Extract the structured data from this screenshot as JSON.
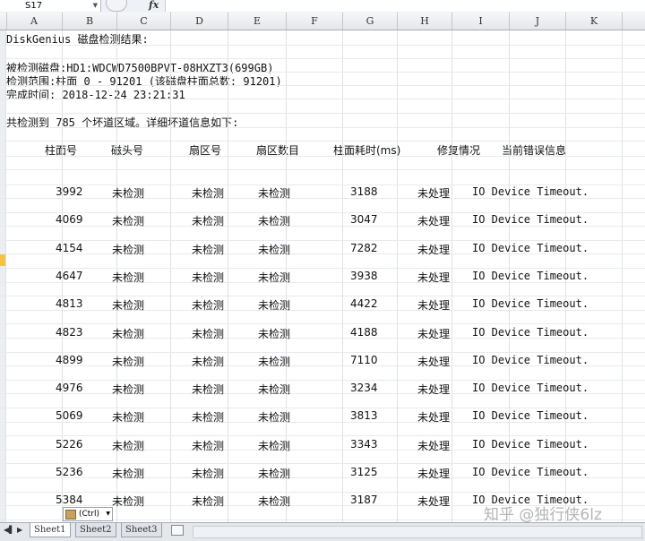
{
  "formula_bar": {
    "cell_ref": "S17",
    "fx": "fx",
    "formula": ""
  },
  "columns": [
    "A",
    "B",
    "C",
    "D",
    "E",
    "F",
    "G",
    "H",
    "I",
    "J",
    "K"
  ],
  "report": {
    "title": "DiskGenius 磁盘检测结果:",
    "disk_line": "被检测磁盘:HD1:WDCWD7500BPVT-08HXZT3(699GB)",
    "range_line": "检测范围:柱面 0 - 91201 (该磁盘柱面总数: 91201)",
    "time_line": "完成时间: 2018-12-24 23:21:31",
    "summary_line": "共检测到 785 个坏道区域。详细坏道信息如下:"
  },
  "table": {
    "headers": {
      "cylinder": "柱面号",
      "head": "磁头号",
      "sector": "扇区号",
      "sector_count": "扇区数目",
      "time": "柱面耗时(ms)",
      "repair": "修复情况",
      "error": "当前错误信息"
    },
    "rows": [
      {
        "cylinder": "3992",
        "head": "未检测",
        "sector": "未检测",
        "sector_count": "未检测",
        "time": "3188",
        "repair": "未处理",
        "error": "IO Device Timeout."
      },
      {
        "cylinder": "4069",
        "head": "未检测",
        "sector": "未检测",
        "sector_count": "未检测",
        "time": "3047",
        "repair": "未处理",
        "error": "IO Device Timeout."
      },
      {
        "cylinder": "4154",
        "head": "未检测",
        "sector": "未检测",
        "sector_count": "未检测",
        "time": "7282",
        "repair": "未处理",
        "error": "IO Device Timeout."
      },
      {
        "cylinder": "4647",
        "head": "未检测",
        "sector": "未检测",
        "sector_count": "未检测",
        "time": "3938",
        "repair": "未处理",
        "error": "IO Device Timeout."
      },
      {
        "cylinder": "4813",
        "head": "未检测",
        "sector": "未检测",
        "sector_count": "未检测",
        "time": "4422",
        "repair": "未处理",
        "error": "IO Device Timeout."
      },
      {
        "cylinder": "4823",
        "head": "未检测",
        "sector": "未检测",
        "sector_count": "未检测",
        "time": "4188",
        "repair": "未处理",
        "error": "IO Device Timeout."
      },
      {
        "cylinder": "4899",
        "head": "未检测",
        "sector": "未检测",
        "sector_count": "未检测",
        "time": "7110",
        "repair": "未处理",
        "error": "IO Device Timeout."
      },
      {
        "cylinder": "4976",
        "head": "未检测",
        "sector": "未检测",
        "sector_count": "未检测",
        "time": "3234",
        "repair": "未处理",
        "error": "IO Device Timeout."
      },
      {
        "cylinder": "5069",
        "head": "未检测",
        "sector": "未检测",
        "sector_count": "未检测",
        "time": "3813",
        "repair": "未处理",
        "error": "IO Device Timeout."
      },
      {
        "cylinder": "5226",
        "head": "未检测",
        "sector": "未检测",
        "sector_count": "未检测",
        "time": "3343",
        "repair": "未处理",
        "error": "IO Device Timeout."
      },
      {
        "cylinder": "5236",
        "head": "未检测",
        "sector": "未检测",
        "sector_count": "未检测",
        "time": "3125",
        "repair": "未处理",
        "error": "IO Device Timeout."
      },
      {
        "cylinder": "5384",
        "head": "未检测",
        "sector": "未检测",
        "sector_count": "未检测",
        "time": "3187",
        "repair": "未处理",
        "error": "IO Device Timeout."
      }
    ]
  },
  "paste_options": {
    "label": "(Ctrl)"
  },
  "sheets": [
    {
      "name": "Sheet1",
      "active": true
    },
    {
      "name": "Sheet2",
      "active": false
    },
    {
      "name": "Sheet3",
      "active": false
    }
  ],
  "watermark": "知乎 @独行侠6lz"
}
